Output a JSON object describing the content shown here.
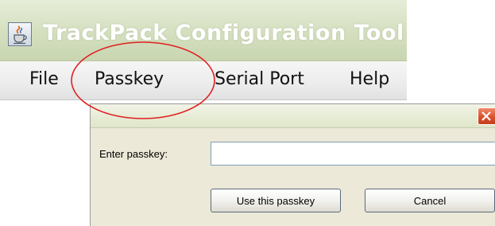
{
  "window": {
    "title": "TrackPack Configuration Tool",
    "icon": "java-cup-icon"
  },
  "menu": {
    "items": [
      {
        "label": "File"
      },
      {
        "label": "Passkey",
        "highlighted": true
      },
      {
        "label": "Serial Port"
      },
      {
        "label": "Help"
      }
    ]
  },
  "annotation": {
    "shape": "ellipse",
    "color": "#e02020",
    "target": "Passkey"
  },
  "dialog": {
    "close_icon": "close-icon",
    "passkey_label": "Enter passkey:",
    "passkey_value": "",
    "confirm_label": "Use this passkey",
    "cancel_label": "Cancel"
  },
  "colors": {
    "title_bar": "#d4dfbf",
    "close_button": "#d9522f",
    "dialog_background": "#ece9d8",
    "input_border": "#7f9db9"
  }
}
